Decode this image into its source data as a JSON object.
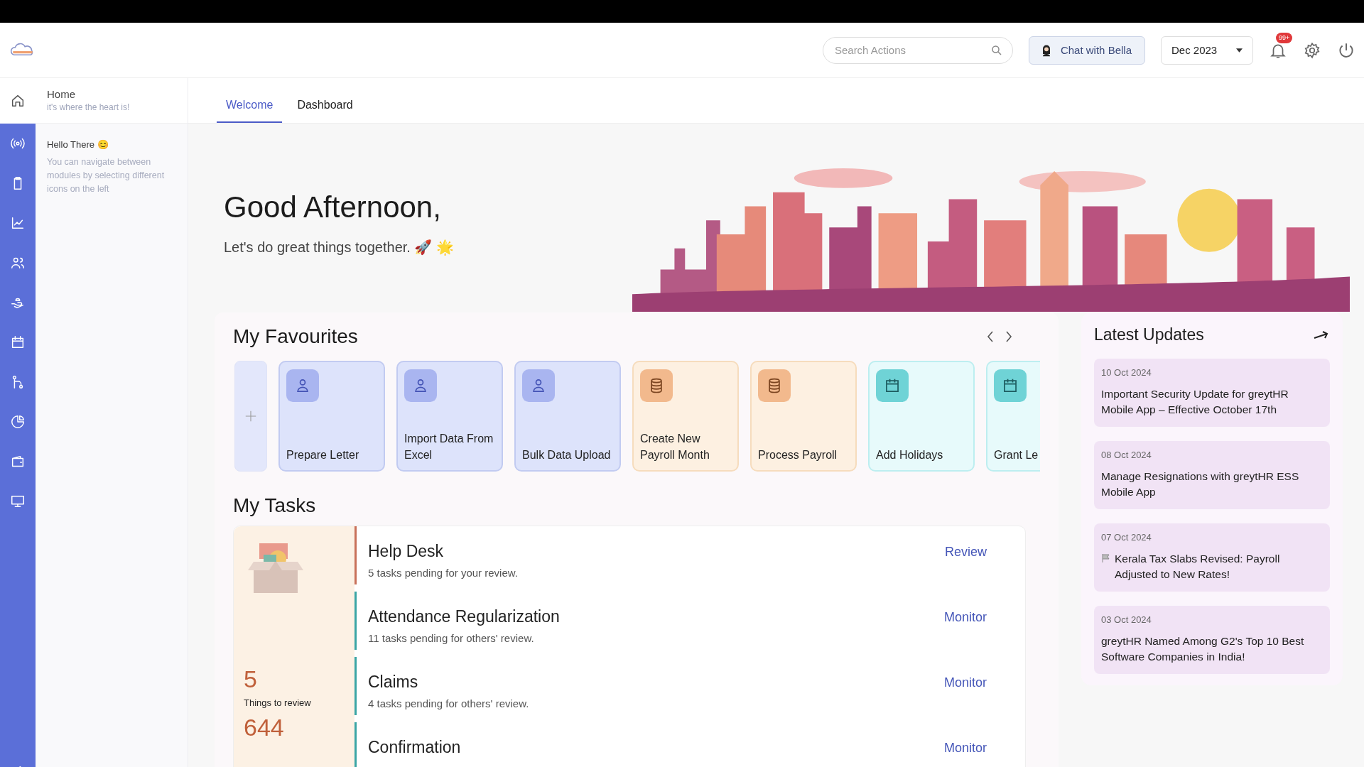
{
  "header": {
    "search": {
      "placeholder": "Search Actions"
    },
    "chat_button": "Chat with Bella",
    "period": "Dec 2023",
    "notification_badge": "99+"
  },
  "rail": [
    {
      "selected": true
    },
    {
      "selected": false
    },
    {
      "selected": false
    },
    {
      "selected": false
    },
    {
      "selected": false
    },
    {
      "selected": false
    },
    {
      "selected": false
    },
    {
      "selected": false
    },
    {
      "selected": false
    },
    {
      "selected": false
    },
    {
      "selected": false
    },
    {
      "selected": false
    }
  ],
  "side_panel": {
    "title": "Home",
    "subtitle": "it's where the heart is!",
    "hint_title": "Hello There 😊",
    "hint_text": "You can navigate between modules by selecting different icons on the left"
  },
  "tabs": [
    {
      "label": "Welcome",
      "selected": true
    },
    {
      "label": "Dashboard",
      "selected": false
    }
  ],
  "greeting": {
    "title": "Good Afternoon,",
    "tagline": "Let's do great things together. 🚀 🌟"
  },
  "favourites": {
    "title": "My Favourites",
    "cards": [
      {
        "label": "Prepare Letter",
        "kind": "person"
      },
      {
        "label": "Import Data From Excel",
        "kind": "person"
      },
      {
        "label": "Bulk Data Upload",
        "kind": "person"
      },
      {
        "label": "Create New Payroll Month",
        "kind": "database"
      },
      {
        "label": "Process Payroll",
        "kind": "database"
      },
      {
        "label": "Add Holidays",
        "kind": "calendar"
      },
      {
        "label": "Grant Le",
        "kind": "calendar"
      }
    ]
  },
  "tasks": {
    "title": "My Tasks",
    "summary": {
      "count": "5",
      "label": "Things to review",
      "total": "644"
    },
    "rows": [
      {
        "title": "Help Desk",
        "subtitle": "5 tasks pending for your review.",
        "action": "Review",
        "color": "#c8705a"
      },
      {
        "title": "Attendance Regularization",
        "subtitle": "11 tasks pending for others' review.",
        "action": "Monitor",
        "color": "#3aa5a5"
      },
      {
        "title": "Claims",
        "subtitle": "4 tasks pending for others' review.",
        "action": "Monitor",
        "color": "#3aa5a5"
      },
      {
        "title": "Confirmation",
        "action": "Monitor",
        "color": "#3aa5a5"
      }
    ]
  },
  "updates": {
    "title": "Latest Updates",
    "items": [
      {
        "date": "10 Oct 2024",
        "text": "Important Security Update for greytHR Mobile App – Effective October 17th",
        "flag": false
      },
      {
        "date": "08 Oct 2024",
        "text": "Manage Resignations with greytHR ESS Mobile App",
        "flag": false
      },
      {
        "date": "07 Oct 2024",
        "text": "Kerala Tax Slabs Revised: Payroll Adjusted to New Rates!",
        "flag": true
      },
      {
        "date": "03 Oct 2024",
        "text": "greytHR Named Among G2's Top 10 Best Software Companies in India!",
        "flag": false
      }
    ]
  }
}
